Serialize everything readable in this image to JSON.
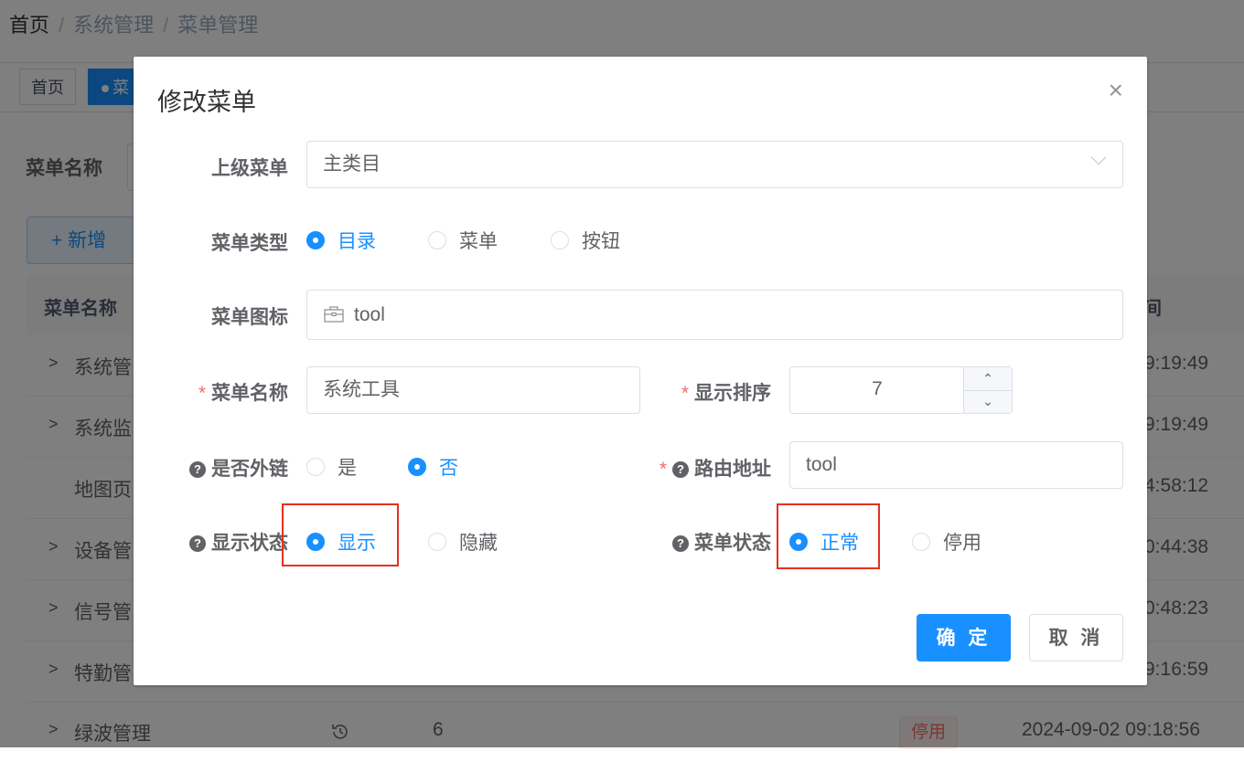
{
  "breadcrumb": [
    "首页",
    "系统管理",
    "菜单管理"
  ],
  "tags": {
    "home": "首页",
    "active": "菜"
  },
  "query": {
    "label": "菜单名称"
  },
  "add_button": "+ 新增",
  "table": {
    "header_name": "菜单名称",
    "header_time": "间",
    "rows": [
      {
        "name": "系统管",
        "time": "9:19:49",
        "expandable": true
      },
      {
        "name": "系统监",
        "time": "9:19:49",
        "expandable": true
      },
      {
        "name": "地图页",
        "time": "4:58:12",
        "expandable": false
      },
      {
        "name": "设备管",
        "time": "0:44:38",
        "expandable": true
      },
      {
        "name": "信号管",
        "time": "0:48:23",
        "expandable": true
      },
      {
        "name": "特勤管",
        "time": "9:16:59",
        "expandable": true
      },
      {
        "name": "绿波管理",
        "icon": "history-icon",
        "order": "6",
        "status": "停用",
        "time": "2024-09-02 09:18:56",
        "expandable": true
      }
    ]
  },
  "dialog": {
    "title": "修改菜单",
    "close": "×",
    "parent_label": "上级菜单",
    "parent_value": "主类目",
    "type_label": "菜单类型",
    "type_options": [
      "目录",
      "菜单",
      "按钮"
    ],
    "type_selected": 0,
    "icon_label": "菜单图标",
    "icon_value": "tool",
    "name_label": "菜单名称",
    "name_value": "系统工具",
    "order_label": "显示排序",
    "order_value": "7",
    "external_label": "是否外链",
    "external_options": [
      "是",
      "否"
    ],
    "external_selected": 1,
    "route_label": "路由地址",
    "route_value": "tool",
    "visible_label": "显示状态",
    "visible_options": [
      "显示",
      "隐藏"
    ],
    "visible_selected": 0,
    "status_label": "菜单状态",
    "status_options": [
      "正常",
      "停用"
    ],
    "status_selected": 0,
    "ok": "确 定",
    "cancel": "取 消"
  },
  "colors": {
    "primary": "#1890ff",
    "highlight": "#e4311f",
    "danger": "#f56c6c"
  }
}
